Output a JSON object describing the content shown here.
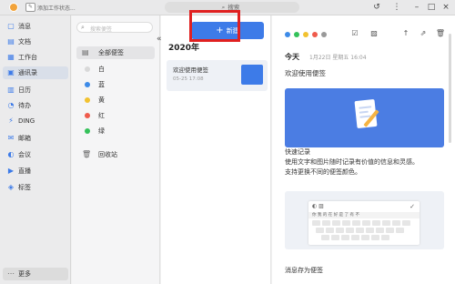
{
  "titlebar": {
    "status_label": "添加工作状态...",
    "search_placeholder": "搜索"
  },
  "sidebar": {
    "items": [
      {
        "label": "消息",
        "icon": "message-icon",
        "glyph": "▢"
      },
      {
        "label": "文档",
        "icon": "document-icon",
        "glyph": "▤"
      },
      {
        "label": "工作台",
        "icon": "workbench-icon",
        "glyph": "▦"
      },
      {
        "label": "通讯录",
        "icon": "contacts-icon",
        "glyph": "▣"
      },
      {
        "label": "日历",
        "icon": "calendar-icon",
        "glyph": "▥"
      },
      {
        "label": "待办",
        "icon": "todo-icon",
        "glyph": "◔"
      },
      {
        "label": "DING",
        "icon": "ding-icon",
        "glyph": "⚡"
      },
      {
        "label": "邮箱",
        "icon": "mail-icon",
        "glyph": "✉"
      },
      {
        "label": "会议",
        "icon": "meeting-icon",
        "glyph": "◐"
      },
      {
        "label": "直播",
        "icon": "live-icon",
        "glyph": "▶"
      },
      {
        "label": "标签",
        "icon": "tag-icon",
        "glyph": "◈"
      }
    ],
    "more_label": "更多",
    "active_index": 3
  },
  "folders": {
    "search_placeholder": "搜索便签",
    "all_label": "全部便签",
    "items": [
      {
        "label": "白",
        "color": "#d9d9d9"
      },
      {
        "label": "蓝",
        "color": "#3d8be8"
      },
      {
        "label": "黄",
        "color": "#f2c230"
      },
      {
        "label": "红",
        "color": "#ef5b4c"
      },
      {
        "label": "绿",
        "color": "#34c15a"
      }
    ],
    "trash_label": "回收站"
  },
  "notes": {
    "new_label": "新建",
    "year": "2020年",
    "list": [
      {
        "title": "欢迎使用便签",
        "date": "05-25 17:08"
      }
    ]
  },
  "detail": {
    "color_dots": [
      "#3d8be8",
      "#34c15a",
      "#f2c230",
      "#ef5b4c",
      "#999999"
    ],
    "today_label": "今天",
    "date_label": "1月22日 星期五 16:04",
    "title": "欢迎使用便签",
    "section_title": "快速记录",
    "line1": "使用文字和图片随时记录有价值的信息和灵感。",
    "line2": "支持更换不同的便签颜色。",
    "bottom_title": "消息存为便签",
    "keyboard_suggest": "你 我 的 在 好 是 了 有 不",
    "accent": "#3d7be8"
  }
}
